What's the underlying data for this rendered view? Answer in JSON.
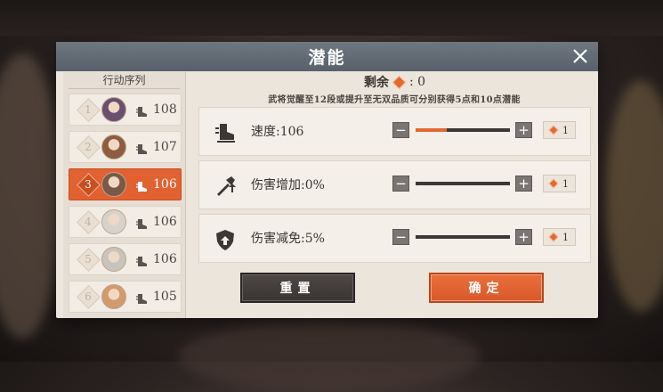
{
  "background": {
    "top_left_text": "[unclear]"
  },
  "modal": {
    "title": "潜能",
    "close_icon": "close-x"
  },
  "action_order": {
    "title": "行动序列",
    "items": [
      {
        "rank": "1",
        "speed": "108",
        "active": false,
        "avatar_color": "#6b4f6e"
      },
      {
        "rank": "2",
        "speed": "107",
        "active": false,
        "avatar_color": "#8e5c3f"
      },
      {
        "rank": "3",
        "speed": "106",
        "active": true,
        "avatar_color": "#7a5a46"
      },
      {
        "rank": "4",
        "speed": "106",
        "active": false,
        "avatar_color": "#d8d2cc"
      },
      {
        "rank": "5",
        "speed": "106",
        "active": false,
        "avatar_color": "#c9c3bd"
      },
      {
        "rank": "6",
        "speed": "105",
        "active": false,
        "avatar_color": "#d29a6d"
      }
    ]
  },
  "potential": {
    "remaining_label": "剩余",
    "remaining_value": ": 0",
    "info": "武将觉醒至12段或提升至无双品质可分别获得5点和10点潜能",
    "stats": [
      {
        "icon": "speed-boot-icon",
        "label": "速度:106",
        "fill": 0.33,
        "cost": "1"
      },
      {
        "icon": "sword-up-icon",
        "label": "伤害增加:0%",
        "fill": 0.0,
        "cost": "1"
      },
      {
        "icon": "shield-up-icon",
        "label": "伤害减免:5%",
        "fill": 0.0,
        "cost": "1"
      }
    ]
  },
  "buttons": {
    "reset": "重置",
    "confirm": "确定"
  },
  "colors": {
    "accent": "#e16131",
    "title_bar": "#5f6872",
    "panel": "#ece5dc"
  }
}
